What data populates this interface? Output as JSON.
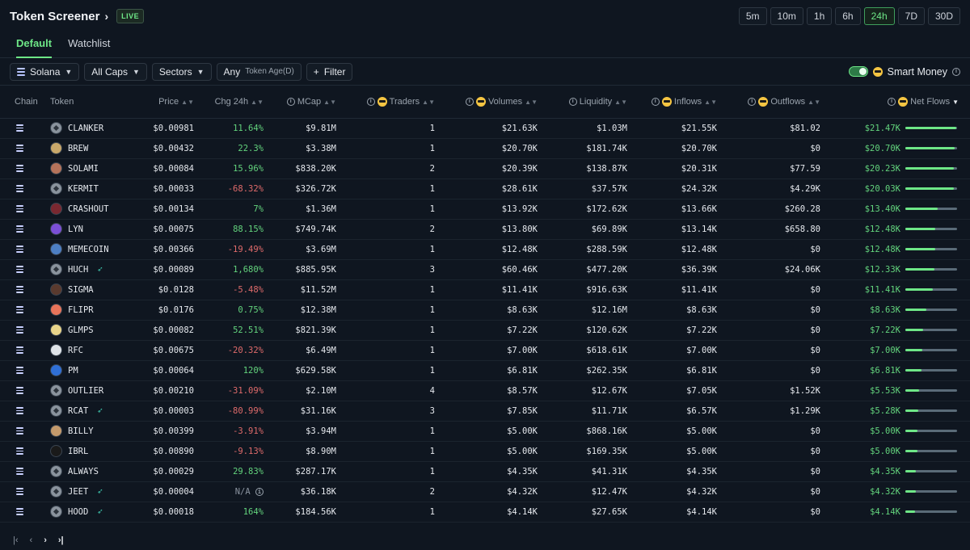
{
  "header": {
    "title": "Token Screener",
    "live_badge": "LIVE",
    "timeframes": [
      "5m",
      "10m",
      "1h",
      "6h",
      "24h",
      "7D",
      "30D"
    ],
    "active_timeframe": "24h"
  },
  "tabs": [
    "Default",
    "Watchlist"
  ],
  "filters": {
    "chain": "Solana",
    "caps": "All Caps",
    "sectors": "Sectors",
    "age_value": "Any",
    "age_label": "Token Age(D)",
    "filter_label": "Filter",
    "smart_money": "Smart Money"
  },
  "columns": {
    "chain": "Chain",
    "token": "Token",
    "price": "Price",
    "change": "Chg 24h",
    "mcap": "MCap",
    "traders": "Traders",
    "volumes": "Volumes",
    "liquidity": "Liquidity",
    "inflows": "Inflows",
    "outflows": "Outflows",
    "netflows": "Net Flows"
  },
  "rows": [
    {
      "token": "CLANKER",
      "avatar": "#8a939d",
      "fish": false,
      "price": "$0.00981",
      "change": "11.64%",
      "dir": "pos",
      "mcap": "$9.81M",
      "traders": "1",
      "volumes": "$21.63K",
      "liquidity": "$1.03M",
      "inflows": "$21.55K",
      "outflows": "$81.02",
      "netflows": "$21.47K",
      "bar": 0.99
    },
    {
      "token": "BREW",
      "avatar": "#c9a86a",
      "fish": false,
      "price": "$0.00432",
      "change": "22.3%",
      "dir": "pos",
      "mcap": "$3.38M",
      "traders": "1",
      "volumes": "$20.70K",
      "liquidity": "$181.74K",
      "inflows": "$20.70K",
      "outflows": "$0",
      "netflows": "$20.70K",
      "bar": 0.96
    },
    {
      "token": "SOLAMI",
      "avatar": "#b5735a",
      "fish": false,
      "price": "$0.00084",
      "change": "15.96%",
      "dir": "pos",
      "mcap": "$838.20K",
      "traders": "2",
      "volumes": "$20.39K",
      "liquidity": "$138.87K",
      "inflows": "$20.31K",
      "outflows": "$77.59",
      "netflows": "$20.23K",
      "bar": 0.94
    },
    {
      "token": "KERMIT",
      "avatar": "#8a939d",
      "fish": false,
      "price": "$0.00033",
      "change": "-68.32%",
      "dir": "neg",
      "mcap": "$326.72K",
      "traders": "1",
      "volumes": "$28.61K",
      "liquidity": "$37.57K",
      "inflows": "$24.32K",
      "outflows": "$4.29K",
      "netflows": "$20.03K",
      "bar": 0.93
    },
    {
      "token": "CRASHOUT",
      "avatar": "#7a2830",
      "fish": false,
      "price": "$0.00134",
      "change": "7%",
      "dir": "pos",
      "mcap": "$1.36M",
      "traders": "1",
      "volumes": "$13.92K",
      "liquidity": "$172.62K",
      "inflows": "$13.66K",
      "outflows": "$260.28",
      "netflows": "$13.40K",
      "bar": 0.62
    },
    {
      "token": "LYN",
      "avatar": "#7b4fd6",
      "fish": false,
      "price": "$0.00075",
      "change": "88.15%",
      "dir": "pos",
      "mcap": "$749.74K",
      "traders": "2",
      "volumes": "$13.80K",
      "liquidity": "$69.89K",
      "inflows": "$13.14K",
      "outflows": "$658.80",
      "netflows": "$12.48K",
      "bar": 0.58
    },
    {
      "token": "MEMECOIN",
      "avatar": "#4d7fc4",
      "fish": false,
      "price": "$0.00366",
      "change": "-19.49%",
      "dir": "neg",
      "mcap": "$3.69M",
      "traders": "1",
      "volumes": "$12.48K",
      "liquidity": "$288.59K",
      "inflows": "$12.48K",
      "outflows": "$0",
      "netflows": "$12.48K",
      "bar": 0.58
    },
    {
      "token": "HUCH",
      "avatar": "#8a939d",
      "fish": true,
      "price": "$0.00089",
      "change": "1,680%",
      "dir": "pos",
      "mcap": "$885.95K",
      "traders": "3",
      "volumes": "$60.46K",
      "liquidity": "$477.20K",
      "inflows": "$36.39K",
      "outflows": "$24.06K",
      "netflows": "$12.33K",
      "bar": 0.57
    },
    {
      "token": "SIGMA",
      "avatar": "#5a3a2e",
      "fish": false,
      "price": "$0.0128",
      "change": "-5.48%",
      "dir": "neg",
      "mcap": "$11.52M",
      "traders": "1",
      "volumes": "$11.41K",
      "liquidity": "$916.63K",
      "inflows": "$11.41K",
      "outflows": "$0",
      "netflows": "$11.41K",
      "bar": 0.53
    },
    {
      "token": "FLIPR",
      "avatar": "#e8745a",
      "fish": false,
      "price": "$0.0176",
      "change": "0.75%",
      "dir": "pos",
      "mcap": "$12.38M",
      "traders": "1",
      "volumes": "$8.63K",
      "liquidity": "$12.16M",
      "inflows": "$8.63K",
      "outflows": "$0",
      "netflows": "$8.63K",
      "bar": 0.4
    },
    {
      "token": "GLMPS",
      "avatar": "#e8d48a",
      "fish": false,
      "price": "$0.00082",
      "change": "52.51%",
      "dir": "pos",
      "mcap": "$821.39K",
      "traders": "1",
      "volumes": "$7.22K",
      "liquidity": "$120.62K",
      "inflows": "$7.22K",
      "outflows": "$0",
      "netflows": "$7.22K",
      "bar": 0.34
    },
    {
      "token": "RFC",
      "avatar": "#dfe3e8",
      "fish": false,
      "price": "$0.00675",
      "change": "-20.32%",
      "dir": "neg",
      "mcap": "$6.49M",
      "traders": "1",
      "volumes": "$7.00K",
      "liquidity": "$618.61K",
      "inflows": "$7.00K",
      "outflows": "$0",
      "netflows": "$7.00K",
      "bar": 0.33
    },
    {
      "token": "PM",
      "avatar": "#2f6fd6",
      "fish": false,
      "price": "$0.00064",
      "change": "120%",
      "dir": "pos",
      "mcap": "$629.58K",
      "traders": "1",
      "volumes": "$6.81K",
      "liquidity": "$262.35K",
      "inflows": "$6.81K",
      "outflows": "$0",
      "netflows": "$6.81K",
      "bar": 0.32
    },
    {
      "token": "OUTLIER",
      "avatar": "#8a939d",
      "fish": false,
      "price": "$0.00210",
      "change": "-31.09%",
      "dir": "neg",
      "mcap": "$2.10M",
      "traders": "4",
      "volumes": "$8.57K",
      "liquidity": "$12.67K",
      "inflows": "$7.05K",
      "outflows": "$1.52K",
      "netflows": "$5.53K",
      "bar": 0.26
    },
    {
      "token": "RCAT",
      "avatar": "#8a939d",
      "fish": true,
      "price": "$0.00003",
      "change": "-80.99%",
      "dir": "neg",
      "mcap": "$31.16K",
      "traders": "3",
      "volumes": "$7.85K",
      "liquidity": "$11.71K",
      "inflows": "$6.57K",
      "outflows": "$1.29K",
      "netflows": "$5.28K",
      "bar": 0.25
    },
    {
      "token": "BILLY",
      "avatar": "#c49a6c",
      "fish": false,
      "price": "$0.00399",
      "change": "-3.91%",
      "dir": "neg",
      "mcap": "$3.94M",
      "traders": "1",
      "volumes": "$5.00K",
      "liquidity": "$868.16K",
      "inflows": "$5.00K",
      "outflows": "$0",
      "netflows": "$5.00K",
      "bar": 0.23
    },
    {
      "token": "IBRL",
      "avatar": "#1a1a1a",
      "fish": false,
      "price": "$0.00890",
      "change": "-9.13%",
      "dir": "neg",
      "mcap": "$8.90M",
      "traders": "1",
      "volumes": "$5.00K",
      "liquidity": "$169.35K",
      "inflows": "$5.00K",
      "outflows": "$0",
      "netflows": "$5.00K",
      "bar": 0.23
    },
    {
      "token": "ALWAYS",
      "avatar": "#8a939d",
      "fish": false,
      "price": "$0.00029",
      "change": "29.83%",
      "dir": "pos",
      "mcap": "$287.17K",
      "traders": "1",
      "volumes": "$4.35K",
      "liquidity": "$41.31K",
      "inflows": "$4.35K",
      "outflows": "$0",
      "netflows": "$4.35K",
      "bar": 0.2
    },
    {
      "token": "JEET",
      "avatar": "#8a939d",
      "fish": true,
      "price": "$0.00004",
      "change": "N/A",
      "dir": "na",
      "mcap": "$36.18K",
      "traders": "2",
      "volumes": "$4.32K",
      "liquidity": "$12.47K",
      "inflows": "$4.32K",
      "outflows": "$0",
      "netflows": "$4.32K",
      "bar": 0.2
    },
    {
      "token": "HOOD",
      "avatar": "#8a939d",
      "fish": true,
      "price": "$0.00018",
      "change": "164%",
      "dir": "pos",
      "mcap": "$184.56K",
      "traders": "1",
      "volumes": "$4.14K",
      "liquidity": "$27.65K",
      "inflows": "$4.14K",
      "outflows": "$0",
      "netflows": "$4.14K",
      "bar": 0.19
    }
  ],
  "pager": {
    "first": "|‹",
    "prev": "‹",
    "next": "›",
    "last": "›|"
  }
}
